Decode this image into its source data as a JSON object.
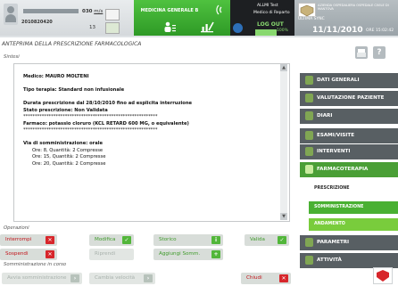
{
  "header": {
    "patient_id": "2010820420",
    "bed_label": "030",
    "bed_unit": "m/s",
    "bed_number": "13",
    "ward": "MEDICINA GENERALE B",
    "user_line_1": "ALLMI Test",
    "user_line_2": "Medico di Reparto",
    "logout_label": "LOG OUT",
    "battery_pct": "100%",
    "battery_level": 1.0,
    "date_label": "ULTIMA SYNC",
    "date": "11/11/2010",
    "time": "ORE 15:02:42",
    "logo_text": "AZIENDA OSPEDALIERA OSPEDALE CIVILE DI MANTOVA"
  },
  "page_title": "ANTEPRIMA DELLA PRESCRIZIONE FARMACOLOGICA",
  "sintesi": {
    "label": "Sintesi",
    "lines": [
      {
        "text": "Medico: MAURO MOLTENI",
        "style": "b"
      },
      {
        "text": "",
        "style": "gap"
      },
      {
        "text": "Tipo terapia: Standard non infusionale",
        "style": "b"
      },
      {
        "text": "",
        "style": "gap"
      },
      {
        "text": "Durata prescrizione dal 28/10/2010 fino ad esplicita interruzione",
        "style": "b"
      },
      {
        "text": "Stato prescrizione: Non Validata",
        "style": "b"
      },
      {
        "text": "**********************************************************",
        "style": ""
      },
      {
        "text": "Farmaco: potassio cloruro (KCL RETARD 600 MG, o equivalente)",
        "style": "b"
      },
      {
        "text": "**********************************************************",
        "style": ""
      },
      {
        "text": "",
        "style": "gap"
      },
      {
        "text": "Via di somministrazione: orale",
        "style": "b"
      },
      {
        "text": "Ore: 8, Quantità: 2 Compresse",
        "style": "ind"
      },
      {
        "text": "Ore: 15, Quantità: 2 Compresse",
        "style": "ind"
      },
      {
        "text": "Ore: 20, Quantità: 2 Compresse",
        "style": "ind"
      }
    ]
  },
  "operazioni": {
    "label": "Operazioni",
    "interrompi": "Interrompi",
    "modifica": "Modifica",
    "storico": "Storico",
    "valida": "Valida",
    "sospendi": "Sospendi",
    "riprendi": "Riprendi",
    "aggiungi": "Aggiungi Somm."
  },
  "somministrazione": {
    "label": "Somministrazione in corso",
    "avvia": "Avvia somministrazione",
    "cambia": "Cambia velocità",
    "chiudi": "Chiudi"
  },
  "nav": {
    "items": [
      {
        "label": "DATI GENERALI"
      },
      {
        "label": "VALUTAZIONE PAZIENTE"
      },
      {
        "label": "DIARI"
      },
      {
        "label": "ESAMI/VISITE"
      },
      {
        "label": "INTERVENTI"
      },
      {
        "label": "FARMACOTERAPIA"
      },
      {
        "label": "PARAMETRI"
      },
      {
        "label": "ATTIVITÀ"
      }
    ],
    "sub_items": [
      {
        "label": "PRESCRIZIONE"
      },
      {
        "label": "SOMMINISTRAZIONE"
      },
      {
        "label": "ANDAMENTO"
      }
    ]
  },
  "colors": {
    "accent_green": "#4a9f36",
    "danger_red": "#d7262b",
    "nav_dark": "#585f63"
  }
}
